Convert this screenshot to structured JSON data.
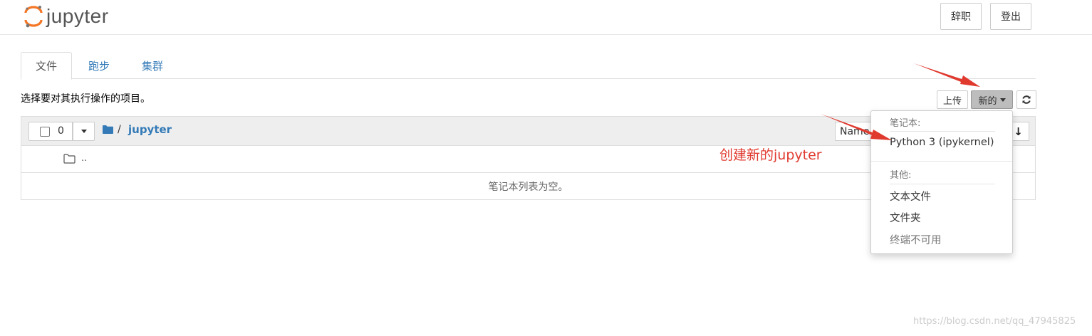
{
  "header": {
    "logo_text": "jupyter",
    "quit_label": "辞职",
    "logout_label": "登出"
  },
  "tabs": [
    {
      "label": "文件",
      "active": true
    },
    {
      "label": "跑步",
      "active": false
    },
    {
      "label": "集群",
      "active": false
    }
  ],
  "toolbar": {
    "instructions": "选择要对其执行操作的项目。",
    "upload_label": "上传",
    "new_label": "新的"
  },
  "file_list": {
    "selected_count": "0",
    "path_separator": "/",
    "current_dir": "jupyter",
    "sort_label": "Name",
    "up_dir": "..",
    "empty_message": "笔记本列表为空。"
  },
  "new_menu": {
    "notebook_header": "笔记本:",
    "kernels": [
      "Python 3 (ipykernel)"
    ],
    "other_header": "其他:",
    "other_items": [
      {
        "label": "文本文件",
        "disabled": false
      },
      {
        "label": "文件夹",
        "disabled": false
      },
      {
        "label": "终端不可用",
        "disabled": true
      }
    ]
  },
  "annotation": {
    "text": "创建新的jupyter",
    "color": "#e03a2f"
  },
  "watermark": "https://blog.csdn.net/qq_47945825",
  "colors": {
    "link": "#337ab7",
    "logo_orange": "#f37726"
  }
}
